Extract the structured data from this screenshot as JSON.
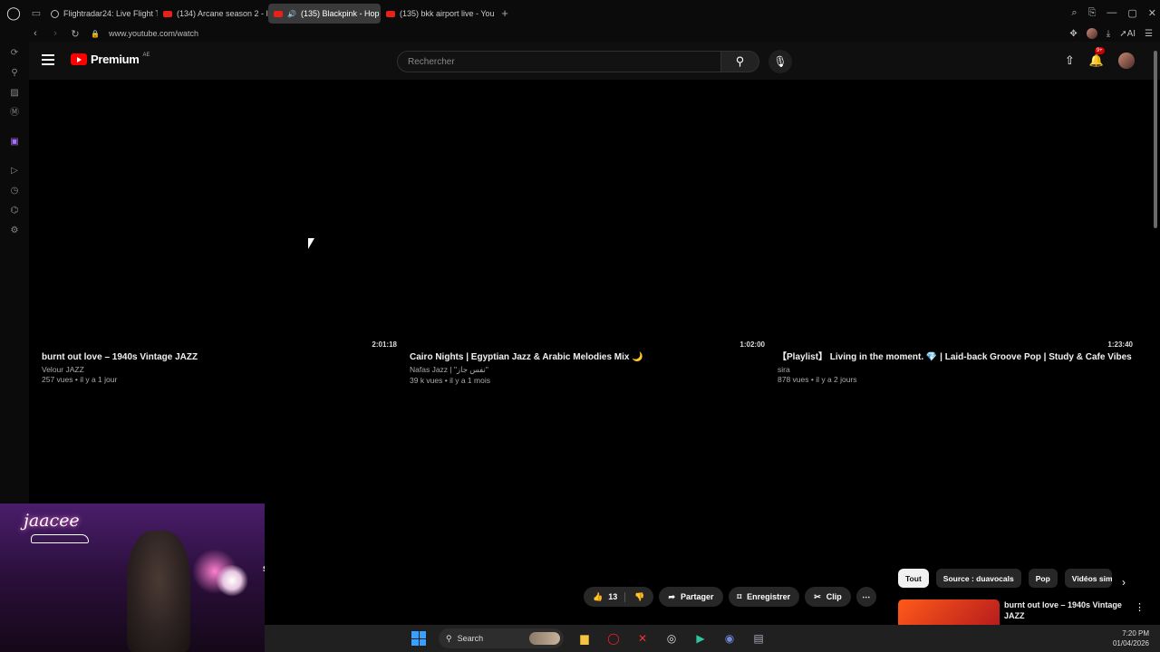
{
  "browser": {
    "tabs": [
      {
        "label": "Flightradar24: Live Flight T",
        "icon": "globe-icon",
        "active": false
      },
      {
        "label": "(134) Arcane season 2 - I",
        "icon": "youtube-icon",
        "active": false
      },
      {
        "label": "(135) Blackpink - Hop",
        "icon": "youtube-icon",
        "active": true
      },
      {
        "label": "(135) bkk airport live - You",
        "icon": "youtube-icon",
        "active": false
      }
    ],
    "url": "www.youtube.com/watch",
    "ai_label": "AI"
  },
  "youtube": {
    "logo_text": "Premium",
    "country_code": "AE",
    "search_placeholder": "Rechercher",
    "notification_badge": "9+"
  },
  "videos": [
    {
      "duration": "2:01:18",
      "title": "burnt out love – 1940s Vintage JAZZ",
      "channel": "Velour JAZZ",
      "meta": "257 vues • il y a 1 jour"
    },
    {
      "duration": "1:02:00",
      "title": "Cairo Nights | Egyptian Jazz & Arabic Melodies Mix 🌙",
      "channel": "Nafas Jazz | \"نفس جاز\"",
      "meta": "39 k vues • il y a 1 mois"
    },
    {
      "duration": "1:23:40",
      "title": "【Playlist】 Living in the moment. 💎 | Laid-back Groove Pop | Study & Cafe Vibes",
      "channel": "sira",
      "meta": "878 vues • il y a 2 jours"
    }
  ],
  "webcam": {
    "handle": "jaacee",
    "peek_text": "s"
  },
  "actions": {
    "like_count": "13",
    "share": "Partager",
    "save": "Enregistrer",
    "clip": "Clip"
  },
  "chips": [
    "Tout",
    "Source : duavocals",
    "Pop",
    "Vidéos sim"
  ],
  "recommendation": {
    "title": "burnt out love – 1940s Vintage JAZZ"
  },
  "taskbar": {
    "search_label": "Search",
    "time": "7:20 PM",
    "date": "01/04/2026"
  }
}
